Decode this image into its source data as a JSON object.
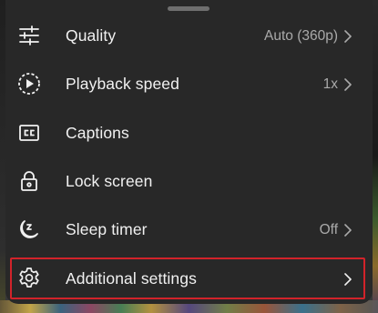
{
  "menu": {
    "items": [
      {
        "id": "quality",
        "label": "Quality",
        "value": "Auto (360p)",
        "icon": "sliders-icon",
        "has_chevron": true
      },
      {
        "id": "playback-speed",
        "label": "Playback speed",
        "value": "1x",
        "icon": "play-circle-icon",
        "has_chevron": true
      },
      {
        "id": "captions",
        "label": "Captions",
        "value": "",
        "icon": "cc-icon",
        "has_chevron": false
      },
      {
        "id": "lock-screen",
        "label": "Lock screen",
        "value": "",
        "icon": "lock-icon",
        "has_chevron": false
      },
      {
        "id": "sleep-timer",
        "label": "Sleep timer",
        "value": "Off",
        "icon": "sleep-moon-icon",
        "has_chevron": true
      },
      {
        "id": "additional-settings",
        "label": "Additional settings",
        "value": "",
        "icon": "gear-icon",
        "has_chevron": true
      }
    ]
  },
  "highlighted_item": "additional-settings",
  "colors": {
    "sheet_background": "#282828",
    "label_text": "#f1f1f1",
    "value_text": "#aaaaaa",
    "highlight_border": "#d2232a"
  }
}
